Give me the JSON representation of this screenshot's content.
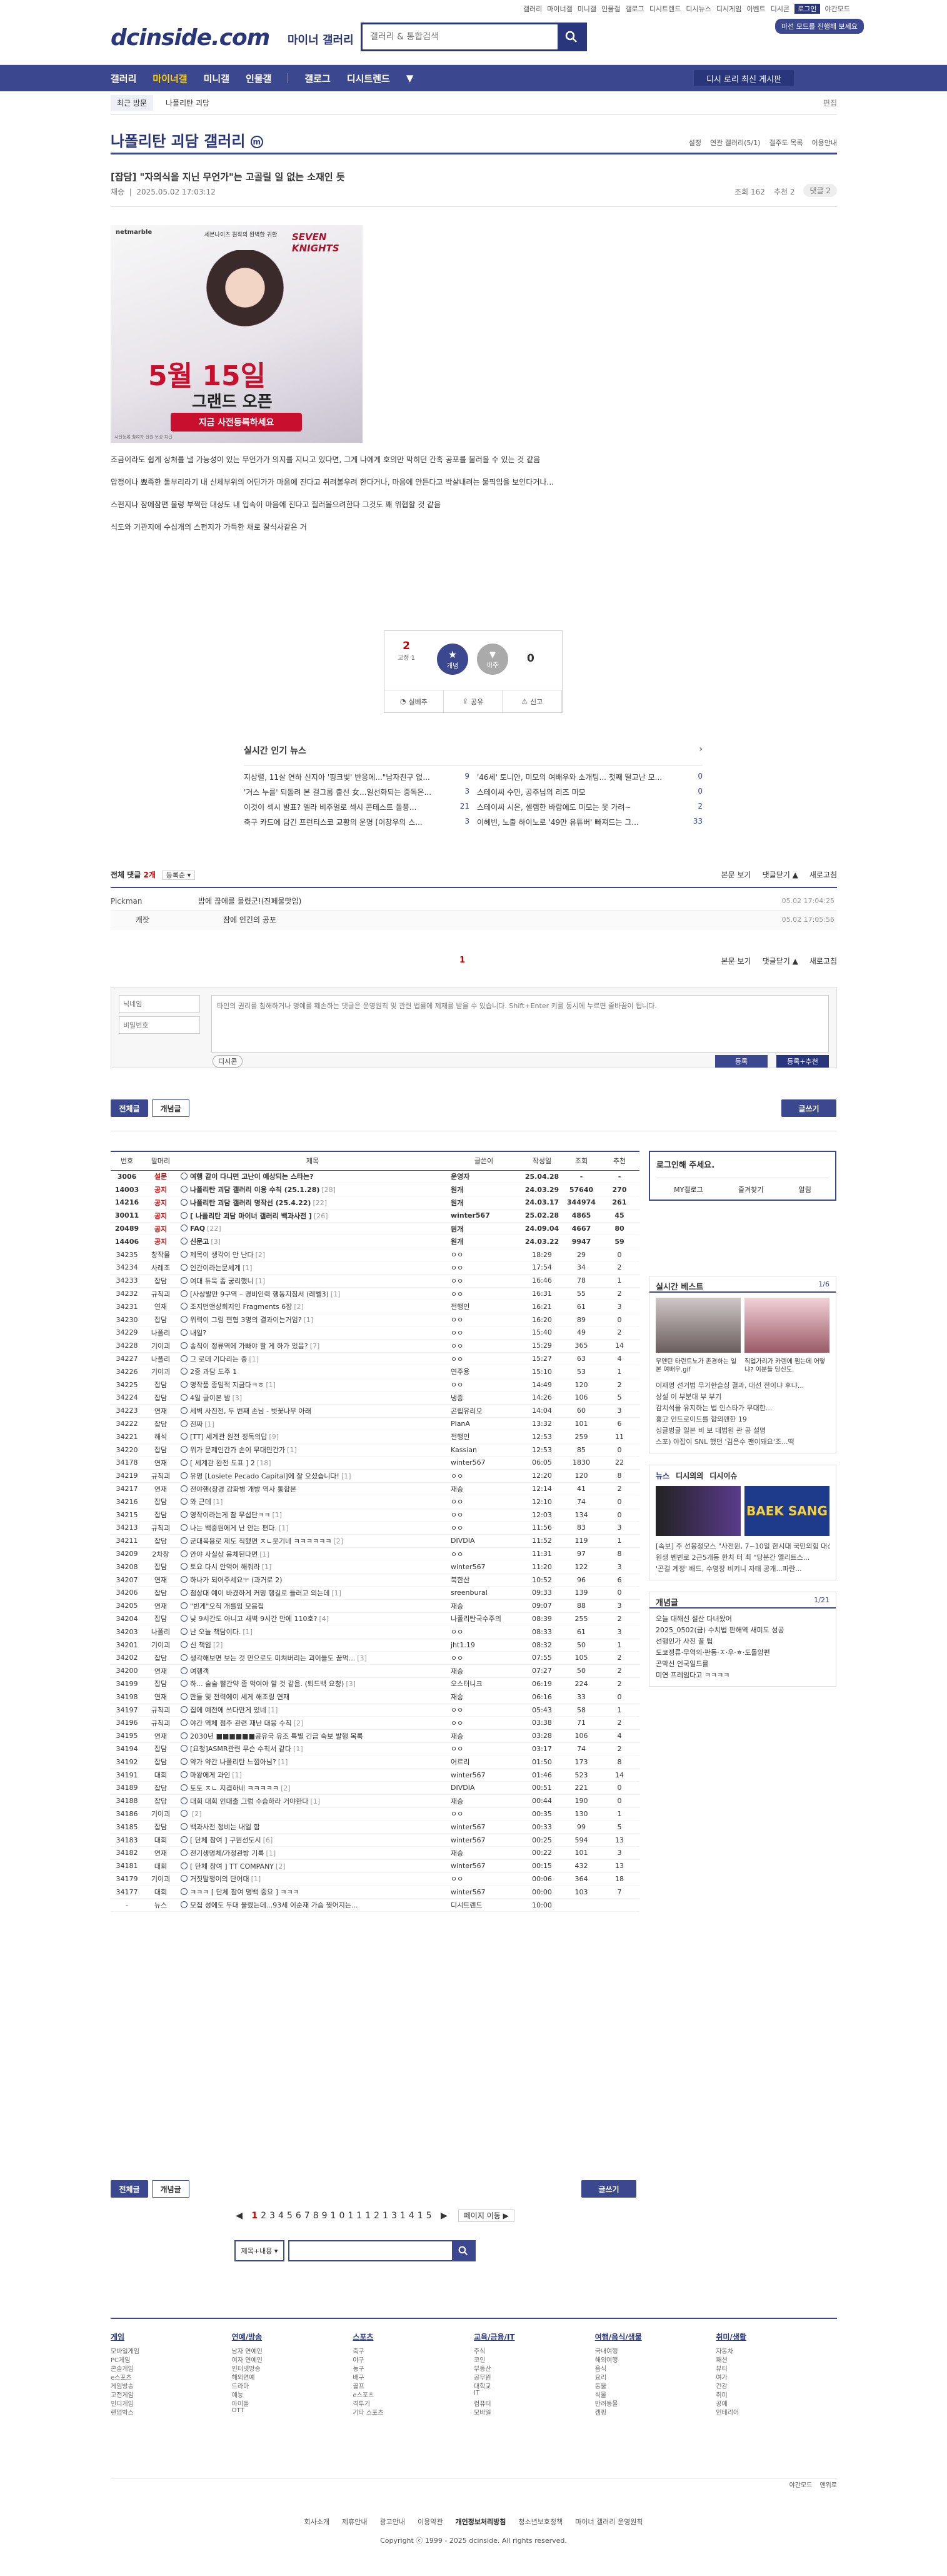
{
  "header": {
    "toplinks": [
      "갤러리",
      "마이너갤",
      "미니갤",
      "인물갤",
      "갤로그",
      "디시트렌드",
      "디시뉴스",
      "디시게임",
      "이벤트",
      "디시콘",
      "로그인",
      "야간모드"
    ],
    "logo": "dcinside.com",
    "logo_sub": "마이너 갤러리",
    "search_placeholder": "갤러리 & 통합검색",
    "promo": "마선 모드를 진행해 보세요"
  },
  "nav": {
    "items": [
      "갤러리",
      "마이너갤",
      "미니갤",
      "인물갤",
      "갤로그",
      "디시트렌드"
    ],
    "more": "▼",
    "recommend": "디시 로리 최신 게시판"
  },
  "subnav": {
    "recent": "최근 방문",
    "item": "나폴리탄 괴담",
    "edit": "편집"
  },
  "gallery": {
    "title": "나폴리탄 괴담 갤러리",
    "opts": [
      "설정",
      "연관 갤러리(5/1)",
      "갤주도 목록",
      "이용안내"
    ]
  },
  "post": {
    "title": "[잡담] \"자의식을 지닌 무언가\"는 고골릴 일 없는 소재인 듯",
    "author": "채승",
    "date": "2025.05.02 17:03:12",
    "views": "조회 162",
    "recs": "추천 2",
    "comments": "댓글 2",
    "body": [
      "조금이라도 쉽게 상처를 낼 가능성이 있는 무언가가 의지를 지니고 있다면, 그게 나에게 호의만 막히던 간혹 공포를 불러올 수 있는 것 같음",
      "압정이나 뾰족한 돌부리라기 내 신체부위의 어딘가가 마음에 진다고 쥐려볼우려 한다거나, 마음에 안든다고 박살내려는 물픽임을 보인다거나...",
      "스펀지나 잠에잠편 물렁 부쩍한 대상도 내 입속이 마음에 진다고 질러볼으려한다 그것도 꽤 위협할 것 같음",
      "식도와 기관지에 수십개의 스펀지가 가득한 채로 잘식사같은 거"
    ],
    "ad": {
      "brand": "netmarble",
      "line1": "세븐나이츠 원작의 완벽한 귀환",
      "game": "SEVEN KNIGHTS",
      "date": "5월 15일",
      "grand": "그랜드 오픈",
      "cta": "지금 사전등록하세요",
      "foot": "사전등록 참여자 전원 보상 지급"
    }
  },
  "vote": {
    "up": "2",
    "fix": "고정 1",
    "up_label": "개념",
    "down_label": "비추",
    "down": "0",
    "share": [
      "실베추",
      "공유",
      "신고"
    ]
  },
  "news": {
    "head": "실시간 인기 뉴스",
    "left": [
      {
        "t": "지상렬, 11살 연하 신지아 '핑크빛' 반응에...\"남자친구 없...",
        "c": "9"
      },
      {
        "t": "'거스 누를' 되돌려 본 걸그룹 출신 女...일선화되는 중독은...",
        "c": "3"
      },
      {
        "t": "이것이 섹시 발표? 엘라 비주얼로 섹시 콘테스트 돌풍...",
        "c": "21"
      },
      {
        "t": "축구 카드에 담긴 프런티스코 교황의 운명 [이창우의 스...",
        "c": "3"
      }
    ],
    "right": [
      {
        "t": "'46세' 토니안, 미모의 여배우와 소개팅... 첫째 떨고난 모...",
        "c": "0"
      },
      {
        "t": "스테이씨 수민, 공주님의 리즈 미모",
        "c": "0"
      },
      {
        "t": "스테이씨 시은, 셀렘한 바람에도 미모는 못 가려~",
        "c": "2"
      },
      {
        "t": "이혜빈, 노출 하이노로 '49만 유튜버' 빠져드는 그...",
        "c": "33"
      }
    ]
  },
  "comments": {
    "head": "전체 댓글",
    "count": "2개",
    "sort": "등록순",
    "opts": [
      "본문 보기",
      "댓글닫기 ▲",
      "새로고침"
    ],
    "items": [
      {
        "nick": "Pickman",
        "text": "밤에 끊에를 물렸군!(진페물맛임)",
        "time": "05.02 17:04:25"
      },
      {
        "nick": "캐잣",
        "text": "잠에 인긴의 공포",
        "time": "05.02 17:05:56"
      }
    ],
    "page": "1",
    "opts2": [
      "본문 보기",
      "댓글닫기 ▲",
      "새로고침"
    ],
    "form": {
      "nick_ph": "닉네임",
      "pw_ph": "비밀번호",
      "text_ph": "타인의 권리를 침해하거나 명예를 훼손하는 댓글은 운영원칙 및 관련 법률에 제재를 받을 수 있습니다. Shift+Enter 키를 동시에 누르면 줄바꿈이 됩니다.",
      "dccon": "디시콘",
      "submit": "등록",
      "submit_rec": "등록+추천"
    }
  },
  "list": {
    "tabs": [
      "전체글",
      "개념글"
    ],
    "write": "글쓰기",
    "headers": [
      "번호",
      "말머리",
      "제목",
      "글쓴이",
      "작성일",
      "조회",
      "추천"
    ],
    "notices": [
      {
        "n": "3006",
        "h": "설문",
        "t": "여행 같이 다니면 고난이 예상되는 스타는?",
        "c": "",
        "w": "운영자",
        "d": "25.04.28",
        "v": "-",
        "r": "-"
      },
      {
        "n": "14003",
        "h": "공지",
        "t": "나폴리탄 괴담 갤러리 이용 수칙 (25.1.28)",
        "c": "[28]",
        "w": "원개",
        "d": "24.03.29",
        "v": "57640",
        "r": "270"
      },
      {
        "n": "14216",
        "h": "공지",
        "t": "나폴리탄 괴담 갤러리 명작선 (25.4.22)",
        "c": "[22]",
        "w": "원개",
        "d": "24.03.17",
        "v": "344974",
        "r": "261"
      },
      {
        "n": "30011",
        "h": "공지",
        "t": "[ 나폴리탄 괴담 마이너 갤러리 백과사전 ]",
        "c": "[26]",
        "w": "winter567",
        "d": "25.02.28",
        "v": "4865",
        "r": "45"
      },
      {
        "n": "20489",
        "h": "공지",
        "t": "FAQ",
        "c": "[22]",
        "w": "원개",
        "d": "24.09.04",
        "v": "4667",
        "r": "80"
      },
      {
        "n": "14406",
        "h": "공지",
        "t": "신문고",
        "c": "[3]",
        "w": "원개",
        "d": "24.03.22",
        "v": "9947",
        "r": "59"
      }
    ],
    "rows": [
      {
        "n": "34235",
        "h": "창작물",
        "t": "제목이 생각이 안 난다",
        "c": "[2]",
        "w": "ㅇㅇ",
        "d": "18:29",
        "v": "29",
        "r": "0"
      },
      {
        "n": "34234",
        "h": "사례조",
        "t": "인간이라는문세계",
        "c": "[1]",
        "w": "ㅇㅇ",
        "d": "17:54",
        "v": "34",
        "r": "2"
      },
      {
        "n": "34233",
        "h": "잡담",
        "t": "여대 듀욱 좀 궁리했니",
        "c": "[1]",
        "w": "ㅇㅇ",
        "d": "16:46",
        "v": "78",
        "r": "1"
      },
      {
        "n": "34232",
        "h": "규칙괴",
        "t": "[사상발만 9구역 – 경비인력 행동지침서 (레벨3)",
        "c": "[1]",
        "w": "ㅇㅇ",
        "d": "16:31",
        "v": "55",
        "r": "2"
      },
      {
        "n": "34231",
        "h": "연재",
        "t": "조지먼앤상회지인 Fragments 6장",
        "c": "[2]",
        "w": "전행인",
        "d": "16:21",
        "v": "61",
        "r": "3"
      },
      {
        "n": "34230",
        "h": "잡담",
        "t": "위력이 그럼 편협 3명의 결과이는거임?",
        "c": "[1]",
        "w": "ㅇㅇ",
        "d": "16:20",
        "v": "89",
        "r": "0"
      },
      {
        "n": "34229",
        "h": "나폴리",
        "t": "내일?",
        "c": "",
        "w": "ㅇㅇ",
        "d": "15:40",
        "v": "49",
        "r": "2"
      },
      {
        "n": "34228",
        "h": "기이괴",
        "t": "송직이 정류역에 가빠야 할 게 하가 있음?",
        "c": "[7]",
        "w": "ㅇㅇ",
        "d": "15:29",
        "v": "365",
        "r": "14"
      },
      {
        "n": "34227",
        "h": "나폴리",
        "t": "그 로데 기다리는 중",
        "c": "[1]",
        "w": "ㅇㅇ",
        "d": "15:27",
        "v": "63",
        "r": "4"
      },
      {
        "n": "34226",
        "h": "기이괴",
        "t": "2중 과담 도주 1",
        "c": "",
        "w": "연주용",
        "d": "15:10",
        "v": "53",
        "r": "1"
      },
      {
        "n": "34225",
        "h": "잡담",
        "t": "명작품 종임적 지금다ㅋㅎ",
        "c": "[1]",
        "w": "ㅇㅇ",
        "d": "14:49",
        "v": "120",
        "r": "2"
      },
      {
        "n": "34224",
        "h": "잡담",
        "t": "4일 글이본 밤",
        "c": "[3]",
        "w": "냉증",
        "d": "14:26",
        "v": "106",
        "r": "5"
      },
      {
        "n": "34223",
        "h": "연재",
        "t": "세벽 사진전, 두 번째 손님 - 벗꽃나무 아래",
        "c": "",
        "w": "곤립유리오",
        "d": "14:04",
        "v": "60",
        "r": "3"
      },
      {
        "n": "34222",
        "h": "잡담",
        "t": "진짜",
        "c": "[1]",
        "w": "PlanA",
        "d": "13:32",
        "v": "101",
        "r": "6"
      },
      {
        "n": "34221",
        "h": "해석",
        "t": "[TT] 세계관 원전 정독의답",
        "c": "[9]",
        "w": "전행인",
        "d": "12:53",
        "v": "259",
        "r": "11"
      },
      {
        "n": "34220",
        "h": "잡담",
        "t": "위가 문제인간가 손이 무대민간가",
        "c": "[1]",
        "w": "Kassian",
        "d": "12:53",
        "v": "85",
        "r": "0"
      },
      {
        "n": "34178",
        "h": "연재",
        "t": "[ 세계관 완전 도표 ] 2",
        "c": "[18]",
        "w": "winter567",
        "d": "06:05",
        "v": "1830",
        "r": "22"
      },
      {
        "n": "34219",
        "h": "규칙괴",
        "t": "유명 [Losiete Pecado Capital]에 잘 오셨습니다!",
        "c": "[1]",
        "w": "ㅇㅇ",
        "d": "12:20",
        "v": "120",
        "r": "8"
      },
      {
        "n": "34217",
        "h": "연재",
        "t": "전야핸(창경 감화병 개방 역사 통합본",
        "c": "",
        "w": "재승",
        "d": "12:14",
        "v": "41",
        "r": "2"
      },
      {
        "n": "34216",
        "h": "잡담",
        "t": "와 근데",
        "c": "[1]",
        "w": "ㅇㅇ",
        "d": "12:10",
        "v": "74",
        "r": "0"
      },
      {
        "n": "34215",
        "h": "잡담",
        "t": "영작이라는게 참 무섭단ㅋㅋ",
        "c": "[1]",
        "w": "ㅇㅇ",
        "d": "12:03",
        "v": "134",
        "r": "0"
      },
      {
        "n": "34213",
        "h": "규칙괴",
        "t": "나는 백중원에게 난 안는 편다.",
        "c": "[1]",
        "w": "ㅇㅇ",
        "d": "11:56",
        "v": "83",
        "r": "3"
      },
      {
        "n": "34211",
        "h": "잡담",
        "t": "군대목용로 제도 직했면 ㅈㄴ웃기네 ㅋㅋㅋㅋㅋㅋ",
        "c": "[2]",
        "w": "DIVDIA",
        "d": "11:52",
        "v": "119",
        "r": "1"
      },
      {
        "n": "34209",
        "h": "2차창",
        "t": "안야 사실상 음체된다면",
        "c": "[1]",
        "w": "ㅇㅇ",
        "d": "11:31",
        "v": "97",
        "r": "8"
      },
      {
        "n": "34208",
        "h": "잡담",
        "t": "토요 다시 안먹어 해줘라",
        "c": "[1]",
        "w": "winter567",
        "d": "11:20",
        "v": "122",
        "r": "3"
      },
      {
        "n": "34207",
        "h": "연재",
        "t": "하나가 되어주세요ㅜ (과거로 2)",
        "c": "",
        "w": "북한산",
        "d": "10:52",
        "v": "96",
        "r": "6"
      },
      {
        "n": "34206",
        "h": "잡담",
        "t": "첨상대 예이 바겼하게 커밍 행길로 들러고 의는데",
        "c": "[1]",
        "w": "sreenbural",
        "d": "09:33",
        "v": "139",
        "r": "0"
      },
      {
        "n": "34205",
        "h": "연재",
        "t": "\"빈게\"오직 개를임 모음집",
        "c": "",
        "w": "재승",
        "d": "09:07",
        "v": "88",
        "r": "3"
      },
      {
        "n": "34204",
        "h": "잡담",
        "t": "낮 9시간도 아니고 새벽 9시간 만에 110호?",
        "c": "[4]",
        "w": "나폴리탄국수주의",
        "d": "08:39",
        "v": "255",
        "r": "2"
      },
      {
        "n": "34203",
        "h": "나폴리",
        "t": "난 오늘 책담이다.",
        "c": "[1]",
        "w": "ㅇㅇ",
        "d": "08:33",
        "v": "61",
        "r": "3"
      },
      {
        "n": "34201",
        "h": "기이괴",
        "t": "신 책임",
        "c": "[2]",
        "w": "jht1.19",
        "d": "08:32",
        "v": "50",
        "r": "1"
      },
      {
        "n": "34202",
        "h": "잡담",
        "t": "생각해보면 보는 것 만으로도 미쳐버리는 괴이들도 꿈먹...",
        "c": "[3]",
        "w": "ㅇㅇ",
        "d": "07:55",
        "v": "105",
        "r": "2"
      },
      {
        "n": "34200",
        "h": "연재",
        "t": "여행객",
        "c": "",
        "w": "재승",
        "d": "07:27",
        "v": "50",
        "r": "2"
      },
      {
        "n": "34199",
        "h": "잡담",
        "t": "하... 술술 빨간약 좀 먹여야 할 것 같음. (퇴드백 요청)",
        "c": "[3]",
        "w": "오스터니크",
        "d": "06:19",
        "v": "224",
        "r": "2"
      },
      {
        "n": "34198",
        "h": "연재",
        "t": "만들 및 전력에이 세게 해조링 연재",
        "c": "",
        "w": "재승",
        "d": "06:16",
        "v": "33",
        "r": "0"
      },
      {
        "n": "34197",
        "h": "규칙괴",
        "t": "집에 예전에 쓰다만게 있네",
        "c": "[1]",
        "w": "ㅇㅇ",
        "d": "05:43",
        "v": "58",
        "r": "1"
      },
      {
        "n": "34196",
        "h": "규칙괴",
        "t": "야간 역체 점주 관련 재난 대응 수칙",
        "c": "[2]",
        "w": "ㅇㅇ",
        "d": "03:38",
        "v": "71",
        "r": "2"
      },
      {
        "n": "34195",
        "h": "연재",
        "t": "2030년 ■■■■■■공유국 유조 특별 긴급 숙보 발행 목록",
        "c": "",
        "w": "재승",
        "d": "03:28",
        "v": "106",
        "r": "4"
      },
      {
        "n": "34194",
        "h": "잡담",
        "t": "[요청]ASMR관련 무슨 수칙서 같다",
        "c": "[1]",
        "w": "ㅇㅇ",
        "d": "03:17",
        "v": "74",
        "r": "2"
      },
      {
        "n": "34192",
        "h": "잡담",
        "t": "약가 약간 나폴리탄 느낌아님?",
        "c": "[1]",
        "w": "어르리",
        "d": "01:50",
        "v": "173",
        "r": "8"
      },
      {
        "n": "34191",
        "h": "대회",
        "t": "마왕에게 과인",
        "c": "[1]",
        "w": "winter567",
        "d": "01:46",
        "v": "523",
        "r": "14"
      },
      {
        "n": "34189",
        "h": "잡담",
        "t": "토토 ㅈㄴ 지겹하네 ㅋㅋㅋㅋㅋ",
        "c": "[2]",
        "w": "DIVDIA",
        "d": "00:51",
        "v": "221",
        "r": "0"
      },
      {
        "n": "34188",
        "h": "잡담",
        "t": "대회 대회 인대출 그럼 수습하라 거야한다",
        "c": "[1]",
        "w": "재승",
        "d": "00:44",
        "v": "190",
        "r": "0"
      },
      {
        "n": "34186",
        "h": "기이괴",
        "t": "",
        "c": "[2]",
        "w": "ㅇㅇ",
        "d": "00:35",
        "v": "130",
        "r": "1"
      },
      {
        "n": "34185",
        "h": "잡담",
        "t": "백과사전 정비는 내일 함",
        "c": "",
        "w": "winter567",
        "d": "00:33",
        "v": "99",
        "r": "5"
      },
      {
        "n": "34183",
        "h": "대회",
        "t": "[ 단체 참여 ] 구원선도시",
        "c": "[6]",
        "w": "winter567",
        "d": "00:25",
        "v": "594",
        "r": "13"
      },
      {
        "n": "34182",
        "h": "연재",
        "t": "전기생명체/가정관방 기록",
        "c": "[1]",
        "w": "재승",
        "d": "00:22",
        "v": "101",
        "r": "3"
      },
      {
        "n": "34181",
        "h": "대회",
        "t": "[ 단체 참여 ] TT COMPANY",
        "c": "[2]",
        "w": "winter567",
        "d": "00:15",
        "v": "432",
        "r": "13"
      },
      {
        "n": "34179",
        "h": "기이괴",
        "t": "거짓말쟁이의 단어대",
        "c": "[1]",
        "w": "ㅇㅇ",
        "d": "00:06",
        "v": "364",
        "r": "18"
      },
      {
        "n": "34177",
        "h": "대회",
        "t": "ㅋㅋㅋ [ 단체 참여 명백 중요 ] ㅋㅋㅋ",
        "c": "",
        "w": "winter567",
        "d": "00:00",
        "v": "103",
        "r": "7"
      },
      {
        "n": "-",
        "h": "뉴스",
        "t": "모집 성에도 두대 울렸는데...93세 이순재 가슴 찢어지는...",
        "c": "",
        "w": "디시트렌드",
        "d": "10:00",
        "v": "",
        "r": ""
      }
    ],
    "pages": [
      "1",
      "2",
      "3",
      "4",
      "5",
      "6",
      "7",
      "8",
      "9",
      "10",
      "11",
      "12",
      "13",
      "14",
      "15"
    ],
    "next": "페이지 이동 ▶",
    "search_sel": "제목+내용"
  },
  "side": {
    "login": {
      "title": "로그인해 주세요.",
      "btns": [
        "MY갤로그",
        "즐겨찾기",
        "알림"
      ]
    },
    "best": {
      "head": "실시간 베스트",
      "pg": "1/6",
      "caps": [
        "무엔틴 타란트노가 존경하는 일본 여배우.gif",
        "직업가리가 카렌에 펌는데 어떻냐? 이분들 당신도."
      ],
      "lines": [
        "이재명 선거법 무기한슬싱 결과, 대선 전이냐 후냐...",
        "상설 이 부분대 부 부기",
        "감치석을 유지하는 법 인스타가 무대한...",
        "홍고 인드로이드를 합의앤한 19",
        "싱글벙글 일본 비 보 대법원 관 공 설명",
        "스포) 야잡이 SNL 했던 '김은수 팬이돼요'조...떡"
      ]
    },
    "news": {
      "tabs": [
        "뉴스",
        "디시의의",
        "디시이슈"
      ],
      "cap": "[속보] 주 선봉정모스 \"사전원, 7~10일 한시대 국민의힘 대선후보 최종 선발...",
      "lines": [
        "원생 벤빈로 2근5개동 한치 터 최 \"당분간 엘리트스...",
        "'곤걸 계정' 배드, 수영장 비키니 자태 공개...파란..."
      ]
    },
    "gnews": {
      "head": "개념글",
      "pg": "1/21",
      "items": [
        "오늘 대해선 설산 다녀왔어",
        "2025_0502(금) 수치법 판해역 새미도 성공",
        "선행인가 사진 꿀 팁",
        "도쿄정류·무역의·판동·ㅈ·우·ㅎ·도돌암편",
        "곤막신 인국일드를",
        "미연 프레임다고 ㅋㅋㅋㅋ"
      ]
    }
  },
  "footer": {
    "cols": [
      {
        "h": "게임",
        "items": [
          "모바일게임",
          "PC게임",
          "콘솔게임",
          "e스포츠",
          "게임방송",
          "고전게임",
          "인디게임",
          "랜덤박스"
        ]
      },
      {
        "h": "연예/방송",
        "items": [
          "남자 연예인",
          "여자 연예인",
          "인터넷방송",
          "해외연예",
          "드라마",
          "예능",
          "아이돌",
          "OTT"
        ]
      },
      {
        "h": "스포츠",
        "items": [
          "축구",
          "야구",
          "농구",
          "배구",
          "골프",
          "e스포츠",
          "격투기",
          "기타 스포츠"
        ]
      },
      {
        "h": "교육/금융/IT",
        "items": [
          "주식",
          "코인",
          "부동산",
          "공무원",
          "대학교",
          "IT",
          "컴퓨터",
          "모바일"
        ]
      },
      {
        "h": "여행/음식/생물",
        "items": [
          "국내여행",
          "해외여행",
          "음식",
          "요리",
          "동물",
          "식물",
          "반려동물",
          "캠핑"
        ]
      },
      {
        "h": "취미/생활",
        "items": [
          "자동차",
          "패션",
          "뷰티",
          "여가",
          "건강",
          "취미",
          "공예",
          "인테리어"
        ]
      }
    ],
    "mini": [
      "야간모드",
      "맨위로"
    ],
    "links": [
      "회사소개",
      "제휴안내",
      "광고안내",
      "이용약관",
      "개인정보처리방침",
      "청소년보호정책",
      "마이너 갤러리 운영원칙"
    ],
    "copy": "Copyright ⓒ 1999 - 2025 dcinside. All rights reserved."
  }
}
